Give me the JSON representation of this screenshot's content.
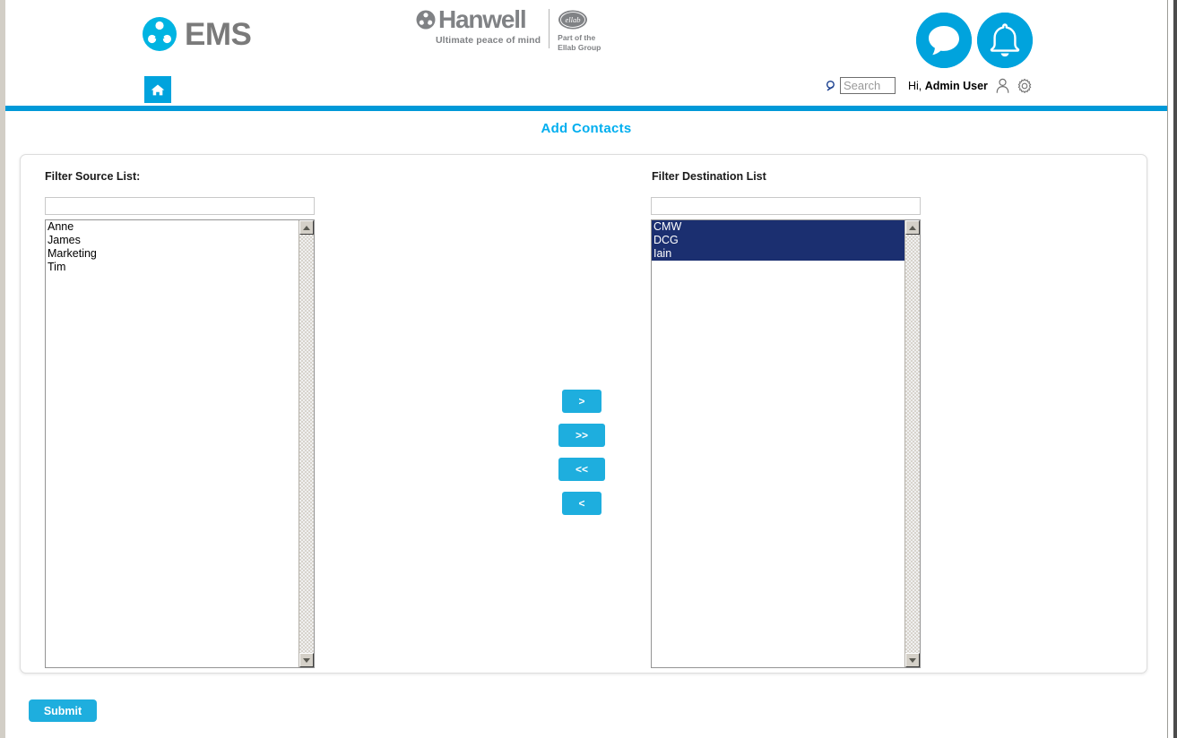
{
  "brand": {
    "ems_name": "EMS",
    "ems_logo_icon": "ems-trefoil-logo-icon",
    "hanwell_name": "Hanwell",
    "hanwell_tagline": "Ultimate peace of mind",
    "hanwell_logo_icon": "hanwell-trefoil-logo-icon",
    "ellab_logo_icon": "ellab-oval-logo-icon",
    "ellab_line1": "Part of the",
    "ellab_line2": "Ellab Group",
    "accent_blue": "#00a3dd",
    "rule_blue": "#0099d8",
    "title_blue": "#00aeef",
    "button_blue": "#1eaede",
    "logo_gray": "#808285"
  },
  "header": {
    "chat_icon": "chat-bubble-icon",
    "bell_icon": "bell-notification-icon",
    "home_icon": "home-icon",
    "search_icon": "search-magnifier-icon",
    "search_placeholder": "Search",
    "search_value": "",
    "greeting_prefix": "Hi,",
    "user_name": "Admin User",
    "user_icon": "user-person-icon",
    "settings_icon": "gear-settings-icon"
  },
  "page": {
    "title": "Add Contacts"
  },
  "source": {
    "label": "Filter Source List:",
    "filter_value": "",
    "filter_placeholder": "",
    "items": [
      {
        "label": "Anne",
        "selected": false
      },
      {
        "label": "James",
        "selected": false
      },
      {
        "label": "Marketing",
        "selected": false
      },
      {
        "label": "Tim",
        "selected": false
      }
    ],
    "scroll_up_icon": "scroll-up-arrow-icon",
    "scroll_down_icon": "scroll-down-arrow-icon"
  },
  "destination": {
    "label": "Filter Destination List",
    "filter_value": "",
    "filter_placeholder": "",
    "items": [
      {
        "label": "CMW",
        "selected": true
      },
      {
        "label": "DCG",
        "selected": true
      },
      {
        "label": "Iain",
        "selected": true
      }
    ],
    "selection_color": "#1b2f70",
    "scroll_up_icon": "scroll-up-arrow-icon",
    "scroll_down_icon": "scroll-down-arrow-icon"
  },
  "transfer": {
    "move_right_label": ">",
    "move_all_right_label": ">>",
    "move_all_left_label": "<<",
    "move_left_label": "<"
  },
  "footer": {
    "submit_label": "Submit"
  }
}
